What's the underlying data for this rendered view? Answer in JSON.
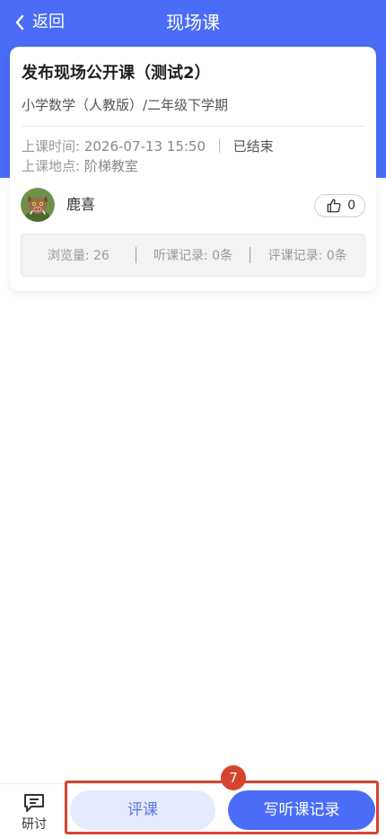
{
  "header": {
    "back_label": "返回",
    "title": "现场课",
    "background_color": "#4a6cf7"
  },
  "course": {
    "title": "发布现场公开课（测试2）",
    "subject": "小学数学（人教版）/二年级下学期",
    "time_label": "上课时间:",
    "time_value": "2026-07-13 15:50",
    "status": "已结束",
    "location_label": "上课地点:",
    "location_value": "阶梯教室"
  },
  "author": {
    "name": "鹿喜",
    "avatar_icon": "boar-avatar-icon"
  },
  "like": {
    "icon": "thumbs-up-icon",
    "count": "0"
  },
  "stats": {
    "views": "浏览量: 26",
    "listen_records": "听课记录: 0条",
    "review_records": "评课记录: 0条"
  },
  "bottom_bar": {
    "discuss_icon": "chat-icon",
    "discuss_label": "研讨",
    "review_button": "评课",
    "write_record_button": "写听课记录",
    "marker_number": "7",
    "highlight_color": "#d6442f"
  }
}
